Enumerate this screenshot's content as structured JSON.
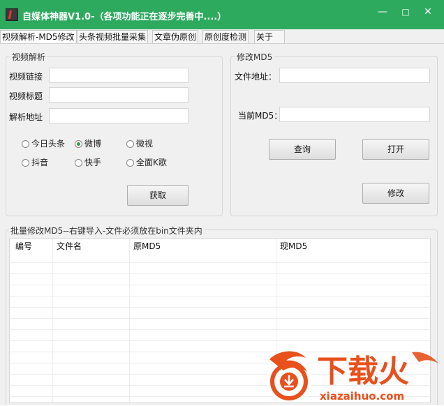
{
  "window": {
    "title": "自媒体神器V1.0-（各项功能正在逐步完善中....）",
    "controls": {
      "minimize": "—",
      "maximize": "□",
      "close": "✕"
    }
  },
  "tabs": [
    {
      "label": "视频解析-MD5修改",
      "active": true
    },
    {
      "label": "头条视频批量采集",
      "active": false
    },
    {
      "label": "文章伪原创",
      "active": false
    },
    {
      "label": "原创度检测",
      "active": false
    },
    {
      "label": "关于",
      "active": false
    }
  ],
  "video_parse": {
    "legend": "视频解析",
    "link_label": "视频链接",
    "link_value": "",
    "title_label": "视频标题",
    "title_value": "",
    "parse_addr_label": "解析地址",
    "parse_addr_value": "",
    "radios": [
      {
        "label": "今日头条",
        "checked": false
      },
      {
        "label": "微博",
        "checked": true
      },
      {
        "label": "微视",
        "checked": false
      },
      {
        "label": "抖音",
        "checked": false
      },
      {
        "label": "快手",
        "checked": false
      },
      {
        "label": "全面K歌",
        "checked": false
      }
    ],
    "fetch_button": "获取"
  },
  "modify_md5": {
    "legend": "修改MD5",
    "file_addr_label": "文件地址：",
    "file_addr_value": "",
    "current_md5_label": "当前MD5：",
    "current_md5_value": "",
    "query_button": "查询",
    "open_button": "打开",
    "modify_button": "修改"
  },
  "batch": {
    "legend": "批量修改MD5--右键导入-文件必须放在bin文件夹内",
    "columns": [
      "编号",
      "文件名",
      "原MD5",
      "现MD5"
    ],
    "rows": []
  },
  "watermark": {
    "text": "下载火",
    "url_text": "xiazaihuo.com",
    "color": "#e8501c"
  },
  "colors": {
    "titlebar": "#2eaa5f",
    "radio_checked": "#2c9c50"
  }
}
